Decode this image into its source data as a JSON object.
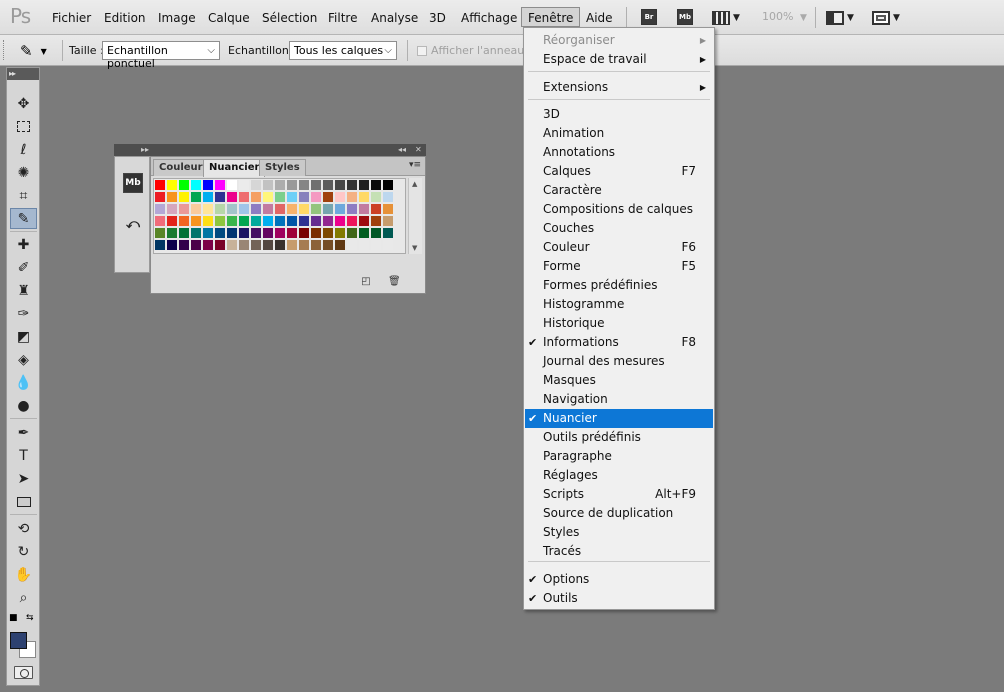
{
  "app": {
    "logo": "Ps"
  },
  "menubar": {
    "items": [
      "Fichier",
      "Edition",
      "Image",
      "Calque",
      "Sélection",
      "Filtre",
      "Analyse",
      "3D",
      "Affichage",
      "Fenêtre",
      "Aide"
    ],
    "active": "Fenêtre",
    "bridge_label": "Br",
    "minibridge_label": "Mb",
    "zoom": "100%"
  },
  "options": {
    "size_label": "Taille :",
    "size_value": "Echantillon ponctuel",
    "sample_label": "Echantillon :",
    "sample_value": "Tous les calques",
    "ring_label": "Afficher l'anneau d'é"
  },
  "panel": {
    "tabs": [
      "Couleur",
      "Nuancier",
      "Styles"
    ],
    "active_tab": "Nuancier",
    "dock_icon_1": "Mb"
  },
  "swatches": {
    "rows": [
      [
        "#ff0000",
        "#ffff00",
        "#00ff00",
        "#00ffff",
        "#0000ff",
        "#ff00ff",
        "#ffffff",
        "#ebebeb",
        "#d6d6d6",
        "#c2c2c2",
        "#adadad",
        "#999999",
        "#858585",
        "#707070",
        "#5c5c5c",
        "#474747",
        "#333333",
        "#1f1f1f",
        "#0a0a0a",
        "#000000"
      ],
      [
        "#ed1c24",
        "#f7941d",
        "#fff200",
        "#00a651",
        "#00aeef",
        "#2e3192",
        "#ec008c",
        "#ee6b6e",
        "#f59f62",
        "#fff67a",
        "#7ccf8c",
        "#6dcff6",
        "#8781bd",
        "#f49ac1",
        "#a0410d",
        "#ffc7c7",
        "#f4b183",
        "#ffd966",
        "#c5e0b4",
        "#bdd7ee"
      ],
      [
        "#b4a7d6",
        "#d5a6bd",
        "#ea9999",
        "#f9cb9c",
        "#ffe599",
        "#b6d7a8",
        "#a2c4c9",
        "#9fc5e8",
        "#8e7cc3",
        "#c27ba0",
        "#e06666",
        "#f6b26b",
        "#ffd966",
        "#93c47d",
        "#76a5af",
        "#6fa8dc",
        "#8e7cc3",
        "#c27ba0",
        "#cc4125",
        "#e69138"
      ],
      [
        "#f16c7a",
        "#e2231a",
        "#f26522",
        "#f7941d",
        "#ffde17",
        "#8dc63f",
        "#39b54a",
        "#00a651",
        "#00a99d",
        "#00aeef",
        "#0072bc",
        "#0054a6",
        "#2e3192",
        "#662d91",
        "#92278f",
        "#ec008c",
        "#ed145b",
        "#9e0b0f",
        "#a0410d",
        "#c69c6d"
      ],
      [
        "#598527",
        "#1a7b30",
        "#007236",
        "#00746b",
        "#0076a3",
        "#004a80",
        "#003471",
        "#1b1464",
        "#440e62",
        "#630460",
        "#9e005d",
        "#9e0039",
        "#790000",
        "#7b2e00",
        "#7d4900",
        "#827b00",
        "#406618",
        "#005e20",
        "#005826",
        "#005952"
      ],
      [
        "#003663",
        "#0d004c",
        "#32004b",
        "#4b0049",
        "#7b0046",
        "#7a0026",
        "#c7b299",
        "#998675",
        "#736357",
        "#534741",
        "#37302d",
        "#c69c6d",
        "#a67c52",
        "#8c6239",
        "#754c24",
        "#603913",
        "#e9e9e9",
        "#e9e9e9",
        "#e9e9e9",
        "#e9e9e9"
      ]
    ]
  },
  "dropdown": {
    "items": [
      {
        "label": "Réorganiser",
        "submenu": true,
        "disabled": true
      },
      {
        "label": "Espace de travail",
        "submenu": true
      },
      {
        "label": "Extensions",
        "submenu": true
      },
      {
        "label": "3D"
      },
      {
        "label": "Animation"
      },
      {
        "label": "Annotations"
      },
      {
        "label": "Calques",
        "shortcut": "F7"
      },
      {
        "label": "Caractère"
      },
      {
        "label": "Compositions de calques"
      },
      {
        "label": "Couches"
      },
      {
        "label": "Couleur",
        "shortcut": "F6"
      },
      {
        "label": "Forme",
        "shortcut": "F5"
      },
      {
        "label": "Formes prédéfinies"
      },
      {
        "label": "Histogramme"
      },
      {
        "label": "Historique"
      },
      {
        "label": "Informations",
        "shortcut": "F8",
        "checked": true
      },
      {
        "label": "Journal des mesures"
      },
      {
        "label": "Masques"
      },
      {
        "label": "Navigation"
      },
      {
        "label": "Nuancier",
        "checked": true,
        "highlighted": true
      },
      {
        "label": "Outils prédéfinis"
      },
      {
        "label": "Paragraphe"
      },
      {
        "label": "Réglages"
      },
      {
        "label": "Scripts",
        "shortcut": "Alt+F9"
      },
      {
        "label": "Source de duplication"
      },
      {
        "label": "Styles"
      },
      {
        "label": "Tracés"
      },
      {
        "label": "Options",
        "checked": true
      },
      {
        "label": "Outils",
        "checked": true
      }
    ]
  },
  "colors": {
    "highlight": "#0d77d6",
    "foreground": "#2d4170",
    "background": "#ffffff",
    "workspace": "#7b7b7b"
  }
}
